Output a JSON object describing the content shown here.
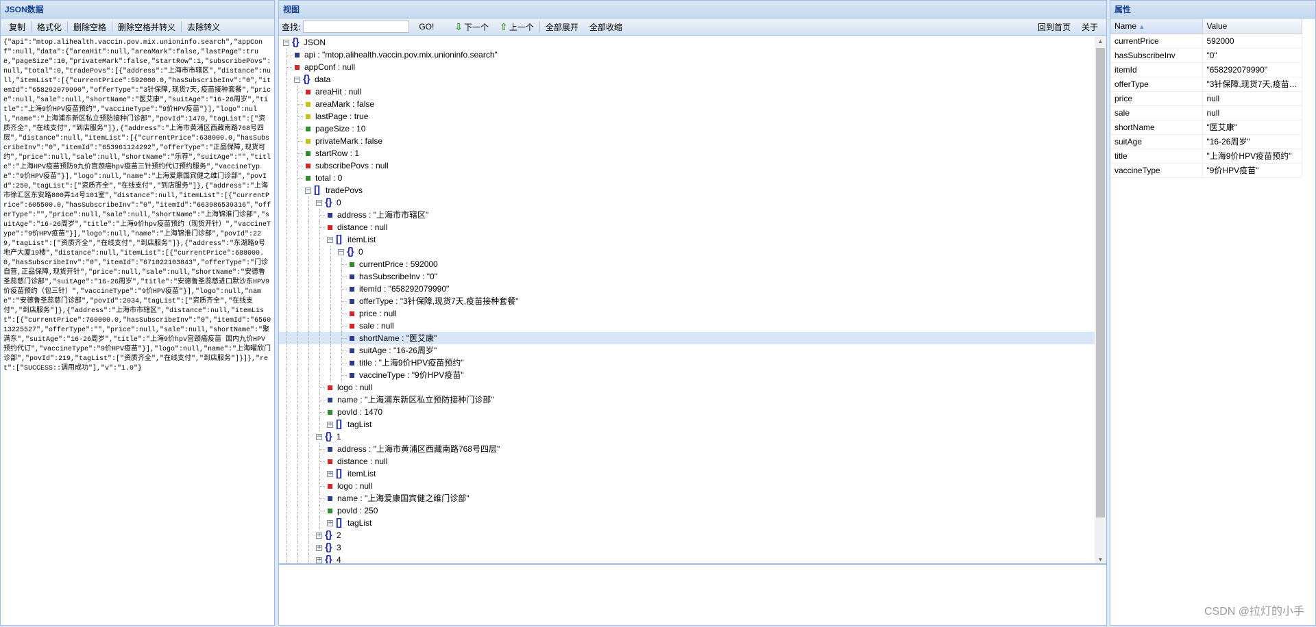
{
  "left": {
    "title": "JSON数据",
    "buttons": [
      "复制",
      "格式化",
      "删除空格",
      "删除空格并转义",
      "去除转义"
    ],
    "json_text": "{\"api\":\"mtop.alihealth.vaccin.pov.mix.unioninfo.search\",\"appConf\":null,\"data\":{\"areaHit\":null,\"areaMark\":false,\"lastPage\":true,\"pageSize\":10,\"privateMark\":false,\"startRow\":1,\"subscribePovs\":null,\"total\":0,\"tradePovs\":[{\"address\":\"上海市市辖区\",\"distance\":null,\"itemList\":[{\"currentPrice\":592000.0,\"hasSubscribeInv\":\"0\",\"itemId\":\"658292079990\",\"offerType\":\"3针保障,现货7天,疫苗接种套餐\",\"price\":null,\"sale\":null,\"shortName\":\"医艾康\",\"suitAge\":\"16-26周岁\",\"title\":\"上海9价HPV疫苗预约\",\"vaccineType\":\"9价HPV疫苗\"}],\"logo\":null,\"name\":\"上海浦东新区私立预防接种门诊部\",\"povId\":1470,\"tagList\":[\"资质齐全\",\"在线支付\",\"到店服务\"]},{\"address\":\"上海市黄浦区西藏南路768号四层\",\"distance\":null,\"itemList\":[{\"currentPrice\":638000.0,\"hasSubscribeInv\":\"0\",\"itemId\":\"653961124292\",\"offerType\":\"正品保障,现货可约\",\"price\":null,\"sale\":null,\"shortName\":\"乐荐\",\"suitAge\":\"\",\"title\":\"上海HPV疫苗预防9九价宫颈癌hpv疫苗三针预约代订预约服务\",\"vaccineType\":\"9价HPV疫苗\"}],\"logo\":null,\"name\":\"上海爱康国宾健之维门诊部\",\"povId\":250,\"tagList\":[\"资质齐全\",\"在线支付\",\"到店服务\"]},{\"address\":\"上海市徐汇区东安路800弄14号101室\",\"distance\":null,\"itemList\":[{\"currentPrice\":605500.0,\"hasSubscribeInv\":\"0\",\"itemId\":\"663986539316\",\"offerType\":\"\",\"price\":null,\"sale\":null,\"shortName\":\"上海锦淮门诊部\",\"suitAge\":\"16-26周岁\",\"title\":\"上海9价hpv疫苗预约（现货开针）\",\"vaccineType\":\"9价HPV疫苗\"}],\"logo\":null,\"name\":\"上海锦淮门诊部\",\"povId\":229,\"tagList\":[\"资质齐全\",\"在线支付\",\"到店服务\"]},{\"address\":\"东湖路9号地产大厦19楼\",\"distance\":null,\"itemList\":[{\"currentPrice\":688000.0,\"hasSubscribeInv\":\"0\",\"itemId\":\"671022103843\",\"offerType\":\"门诊自营,正品保障,现货开针\",\"price\":null,\"sale\":null,\"shortName\":\"安德鲁圣蕊慈门诊部\",\"suitAge\":\"16-26周岁\",\"title\":\"安德鲁圣蕊慈进口默沙东HPV9价疫苗预约（包三针）\",\"vaccineType\":\"9价HPV疫苗\"}],\"logo\":null,\"name\":\"安德鲁圣蕊慈门诊部\",\"povId\":2034,\"tagList\":[\"资质齐全\",\"在线支付\",\"到店服务\"]},{\"address\":\"上海市市辖区\",\"distance\":null,\"itemList\":[{\"currentPrice\":760000.0,\"hasSubscribeInv\":\"0\",\"itemId\":\"656013225527\",\"offerType\":\"\",\"price\":null,\"sale\":null,\"shortName\":\"聚满东\",\"suitAge\":\"16-26周岁\",\"title\":\"上海9价hpv宫颈癌疫苗 国内九价HPV预约代订\",\"vaccineType\":\"9价HPV疫苗\"}],\"logo\":null,\"name\":\"上海曜欣门诊部\",\"povId\":219,\"tagList\":[\"资质齐全\",\"在线支付\",\"到店服务\"]}]},\"ret\":[\"SUCCESS::调用成功\"],\"v\":\"1.0\"}"
  },
  "center": {
    "title": "视图",
    "search_label": "查找:",
    "search_value": "",
    "go": "GO!",
    "next": "下一个",
    "prev": "上一个",
    "expand_all": "全部展开",
    "collapse_all": "全部收缩",
    "home": "回到首页",
    "about": "关于"
  },
  "colors": {
    "string": "#2d3b8f",
    "null": "#d42626",
    "boolean": "#c9c21e",
    "number": "#2f8f2f",
    "brace": "#1f2aa8",
    "selected": "#d9e6f8"
  },
  "tree": {
    "rows": [
      {
        "lv": 0,
        "t": "obj",
        "open": true,
        "label": "JSON"
      },
      {
        "lv": 1,
        "t": "string",
        "label": "api : \"mtop.alihealth.vaccin.pov.mix.unioninfo.search\""
      },
      {
        "lv": 1,
        "t": "null",
        "label": "appConf : null"
      },
      {
        "lv": 1,
        "t": "obj",
        "open": true,
        "label": "data"
      },
      {
        "lv": 2,
        "t": "null",
        "label": "areaHit : null"
      },
      {
        "lv": 2,
        "t": "boolean",
        "label": "areaMark : false"
      },
      {
        "lv": 2,
        "t": "boolean",
        "label": "lastPage : true"
      },
      {
        "lv": 2,
        "t": "number",
        "label": "pageSize : 10"
      },
      {
        "lv": 2,
        "t": "boolean",
        "label": "privateMark : false"
      },
      {
        "lv": 2,
        "t": "number",
        "label": "startRow : 1"
      },
      {
        "lv": 2,
        "t": "null",
        "label": "subscribePovs : null"
      },
      {
        "lv": 2,
        "t": "number",
        "label": "total : 0"
      },
      {
        "lv": 2,
        "t": "arr",
        "open": true,
        "label": "tradePovs"
      },
      {
        "lv": 3,
        "t": "obj",
        "open": true,
        "label": "0"
      },
      {
        "lv": 4,
        "t": "string",
        "label": "address : \"上海市市辖区\""
      },
      {
        "lv": 4,
        "t": "null",
        "label": "distance : null"
      },
      {
        "lv": 4,
        "t": "arr",
        "open": true,
        "label": "itemList"
      },
      {
        "lv": 5,
        "t": "obj",
        "open": true,
        "label": "0"
      },
      {
        "lv": 6,
        "t": "number",
        "label": "currentPrice : 592000"
      },
      {
        "lv": 6,
        "t": "string",
        "label": "hasSubscribeInv : \"0\""
      },
      {
        "lv": 6,
        "t": "string",
        "label": "itemId : \"658292079990\""
      },
      {
        "lv": 6,
        "t": "string",
        "label": "offerType : \"3针保障,现货7天,疫苗接种套餐\""
      },
      {
        "lv": 6,
        "t": "null",
        "label": "price : null"
      },
      {
        "lv": 6,
        "t": "null",
        "label": "sale : null"
      },
      {
        "lv": 6,
        "t": "string",
        "label": "shortName : \"医艾康\"",
        "selected": true
      },
      {
        "lv": 6,
        "t": "string",
        "label": "suitAge : \"16-26周岁\""
      },
      {
        "lv": 6,
        "t": "string",
        "label": "title : \"上海9价HPV疫苗预约\""
      },
      {
        "lv": 6,
        "t": "string",
        "label": "vaccineType : \"9价HPV疫苗\""
      },
      {
        "lv": 4,
        "t": "null",
        "label": "logo : null"
      },
      {
        "lv": 4,
        "t": "string",
        "label": "name : \"上海浦东新区私立预防接种门诊部\""
      },
      {
        "lv": 4,
        "t": "number",
        "label": "povId : 1470"
      },
      {
        "lv": 4,
        "t": "arr",
        "open": false,
        "label": "tagList"
      },
      {
        "lv": 3,
        "t": "obj",
        "open": true,
        "label": "1"
      },
      {
        "lv": 4,
        "t": "string",
        "label": "address : \"上海市黄浦区西藏南路768号四层\""
      },
      {
        "lv": 4,
        "t": "null",
        "label": "distance : null"
      },
      {
        "lv": 4,
        "t": "arr",
        "open": false,
        "label": "itemList"
      },
      {
        "lv": 4,
        "t": "null",
        "label": "logo : null"
      },
      {
        "lv": 4,
        "t": "string",
        "label": "name : \"上海爱康国宾健之维门诊部\""
      },
      {
        "lv": 4,
        "t": "number",
        "label": "povId : 250"
      },
      {
        "lv": 4,
        "t": "arr",
        "open": false,
        "label": "tagList"
      },
      {
        "lv": 3,
        "t": "obj",
        "open": false,
        "label": "2"
      },
      {
        "lv": 3,
        "t": "obj",
        "open": false,
        "label": "3"
      },
      {
        "lv": 3,
        "t": "obj",
        "open": false,
        "label": "4"
      }
    ]
  },
  "properties": {
    "title": "属性",
    "col_name": "Name",
    "col_value": "Value",
    "sort_icon": "▲",
    "rows": [
      {
        "name": "currentPrice",
        "value": "592000"
      },
      {
        "name": "hasSubscribeInv",
        "value": "\"0\""
      },
      {
        "name": "itemId",
        "value": "\"658292079990\""
      },
      {
        "name": "offerType",
        "value": "\"3针保障,现货7天,疫苗接种套餐\""
      },
      {
        "name": "price",
        "value": "null"
      },
      {
        "name": "sale",
        "value": "null"
      },
      {
        "name": "shortName",
        "value": "\"医艾康\""
      },
      {
        "name": "suitAge",
        "value": "\"16-26周岁\""
      },
      {
        "name": "title",
        "value": "\"上海9价HPV疫苗预约\""
      },
      {
        "name": "vaccineType",
        "value": "\"9价HPV疫苗\""
      }
    ]
  },
  "watermark": "CSDN @拉灯的小手"
}
